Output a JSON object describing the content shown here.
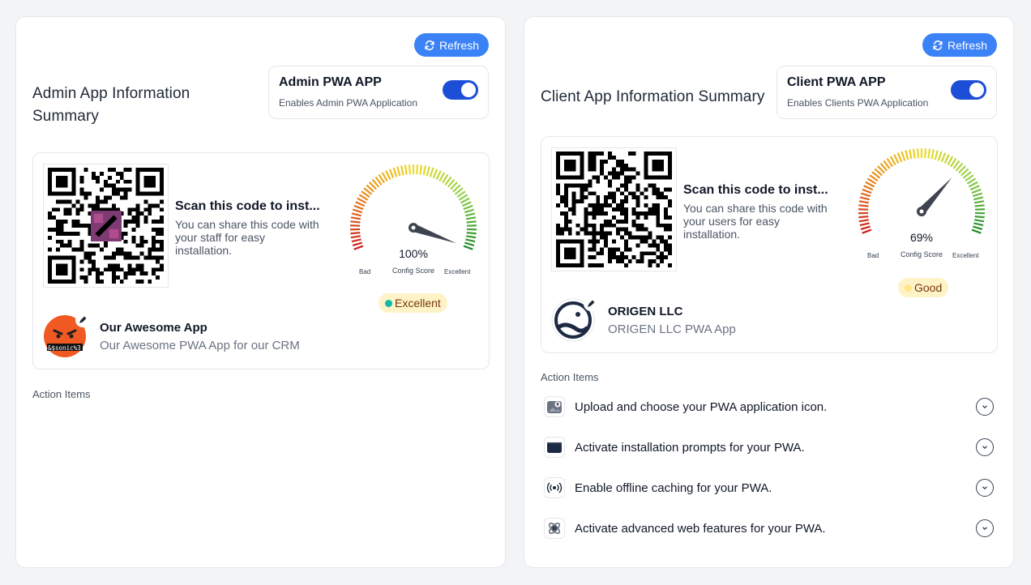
{
  "refresh_label": "Refresh",
  "admin": {
    "title": "Admin App Information Summary",
    "toggle_title": "Admin PWA APP",
    "toggle_sub": "Enables Admin PWA Application",
    "scan_title": "Scan this code to inst...",
    "scan_desc": "You can share this code with your staff for easy installation.",
    "score": "100%",
    "score_value": 100,
    "score_label": "Config Score",
    "bad_label": "Bad",
    "excellent_label": "Excellent",
    "status": "Excellent",
    "status_dot_color": "#14b8a6",
    "app_name": "Our Awesome App",
    "app_desc": "Our Awesome PWA App for our CRM",
    "avatar_text": "&$sonic%3",
    "actions_label": "Action Items"
  },
  "client": {
    "title": "Client App Information Summary",
    "toggle_title": "Client PWA APP",
    "toggle_sub": "Enables Clients PWA Application",
    "scan_title": "Scan this code to inst...",
    "scan_desc": "You can share this code with your users for easy installation.",
    "score": "69%",
    "score_value": 69,
    "score_label": "Config Score",
    "bad_label": "Bad",
    "excellent_label": "Excellent",
    "status": "Good",
    "status_dot_color": "#fde68a",
    "app_name": "ORIGEN LLC",
    "app_desc": "ORIGEN LLC PWA App",
    "actions_label": "Action Items",
    "actions": [
      {
        "label": "Upload and choose your PWA application icon.",
        "icon": "image-upload-icon"
      },
      {
        "label": "Activate installation prompts for your PWA.",
        "icon": "install-prompt-icon"
      },
      {
        "label": "Enable offline caching for your PWA.",
        "icon": "broadcast-icon"
      },
      {
        "label": "Activate advanced web features for your PWA.",
        "icon": "atom-icon"
      }
    ]
  },
  "colors": {
    "accent": "#3b82f6",
    "toggle": "#1d4ed8",
    "badge_bg": "#fef3c7"
  }
}
